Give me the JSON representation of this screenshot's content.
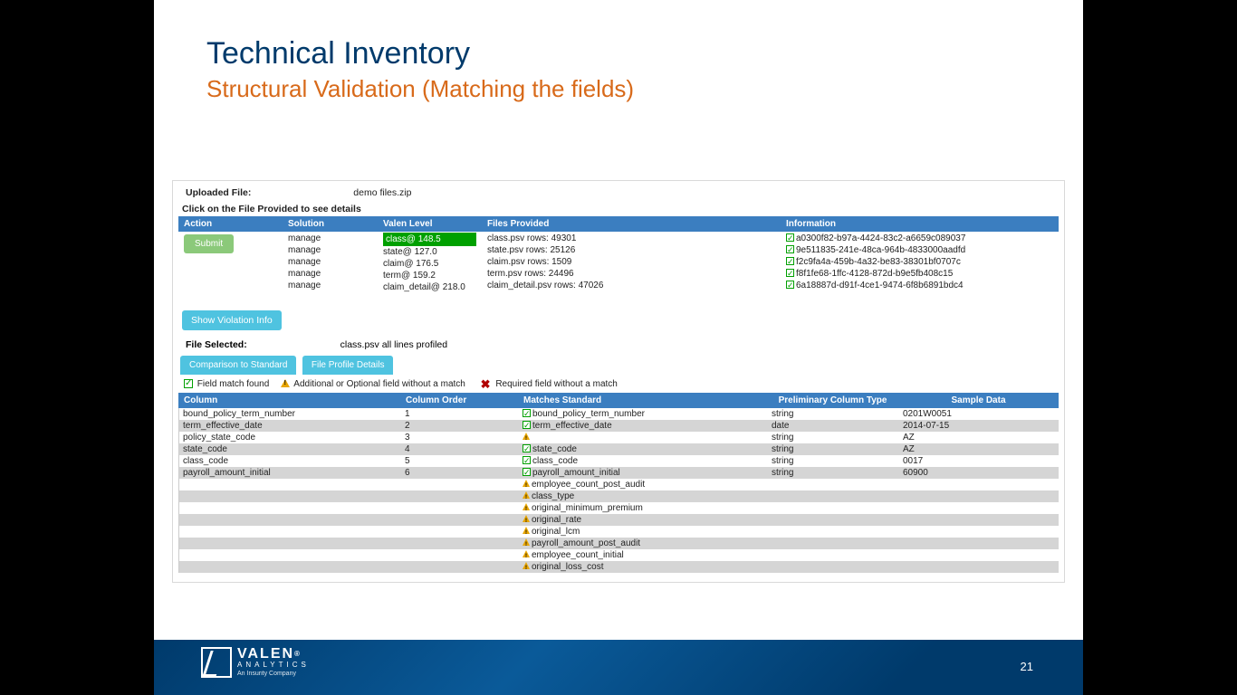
{
  "title": "Technical Inventory",
  "subtitle": "Structural Validation (Matching the fields)",
  "uploaded_label": "Uploaded File:",
  "uploaded_value": "demo files.zip",
  "hint": "Click on the File Provided to see details",
  "hdr": {
    "action": "Action",
    "solution": "Solution",
    "level": "Valen Level",
    "files": "Files Provided",
    "info": "Information"
  },
  "submit": "Submit",
  "rows": [
    {
      "solution": "manage",
      "level": "class@ 148.5",
      "hl": true,
      "files": "class.psv rows: 49301",
      "info": "a0300f82-b97a-4424-83c2-a6659c089037"
    },
    {
      "solution": "manage",
      "level": "state@ 127.0",
      "files": "state.psv rows: 25126",
      "info": "9e511835-241e-48ca-964b-4833000aadfd"
    },
    {
      "solution": "manage",
      "level": "claim@ 176.5",
      "files": "claim.psv rows: 1509",
      "info": "f2c9fa4a-459b-4a32-be83-38301bf0707c"
    },
    {
      "solution": "manage",
      "level": "term@ 159.2",
      "files": "term.psv rows: 24496",
      "info": "f8f1fe68-1ffc-4128-872d-b9e5fb408c15"
    },
    {
      "solution": "manage",
      "level": "claim_detail@ 218.0",
      "files": "claim_detail.psv rows: 47026",
      "info": "6a18887d-d91f-4ce1-9474-6f8b6891bdc4"
    }
  ],
  "violation_btn": "Show Violation Info",
  "selected_label": "File Selected:",
  "selected_value": "class.psv all lines profiled",
  "tabs": {
    "t1": "Comparison to Standard",
    "t2": "File Profile Details"
  },
  "legend": {
    "l1": "Field match found",
    "l2": "Additional or Optional field without a match",
    "l3": "Required field without a match"
  },
  "ghdr": {
    "col": "Column",
    "ord": "Column Order",
    "match": "Matches Standard",
    "type": "Preliminary Column Type",
    "sample": "Sample Data"
  },
  "grid": [
    {
      "col": "bound_policy_term_number",
      "ord": "1",
      "match": "bound_policy_term_number",
      "icon": "chk",
      "type": "string",
      "sample": "0201W0051"
    },
    {
      "col": "term_effective_date",
      "ord": "2",
      "match": "term_effective_date",
      "icon": "chk",
      "type": "date",
      "sample": "2014-07-15"
    },
    {
      "col": "policy_state_code",
      "ord": "3",
      "match": "",
      "icon": "warn",
      "type": "string",
      "sample": "AZ"
    },
    {
      "col": "state_code",
      "ord": "4",
      "match": "state_code",
      "icon": "chk",
      "type": "string",
      "sample": "AZ"
    },
    {
      "col": "class_code",
      "ord": "5",
      "match": "class_code",
      "icon": "chk",
      "type": "string",
      "sample": "0017"
    },
    {
      "col": "payroll_amount_initial",
      "ord": "6",
      "match": "payroll_amount_initial",
      "icon": "chk",
      "type": "string",
      "sample": "60900"
    },
    {
      "col": "",
      "ord": "",
      "match": "employee_count_post_audit",
      "icon": "warn",
      "type": "",
      "sample": ""
    },
    {
      "col": "",
      "ord": "",
      "match": "class_type",
      "icon": "warn",
      "type": "",
      "sample": ""
    },
    {
      "col": "",
      "ord": "",
      "match": "original_minimum_premium",
      "icon": "warn",
      "type": "",
      "sample": ""
    },
    {
      "col": "",
      "ord": "",
      "match": "original_rate",
      "icon": "warn",
      "type": "",
      "sample": ""
    },
    {
      "col": "",
      "ord": "",
      "match": "original_lcm",
      "icon": "warn",
      "type": "",
      "sample": ""
    },
    {
      "col": "",
      "ord": "",
      "match": "payroll_amount_post_audit",
      "icon": "warn",
      "type": "",
      "sample": ""
    },
    {
      "col": "",
      "ord": "",
      "match": "employee_count_initial",
      "icon": "warn",
      "type": "",
      "sample": ""
    },
    {
      "col": "",
      "ord": "",
      "match": "original_loss_cost",
      "icon": "warn",
      "type": "",
      "sample": ""
    }
  ],
  "logo": {
    "t1": "VALEN",
    "t2": "ANALYTICS",
    "t3": "An Insurity Company"
  },
  "page": "21"
}
